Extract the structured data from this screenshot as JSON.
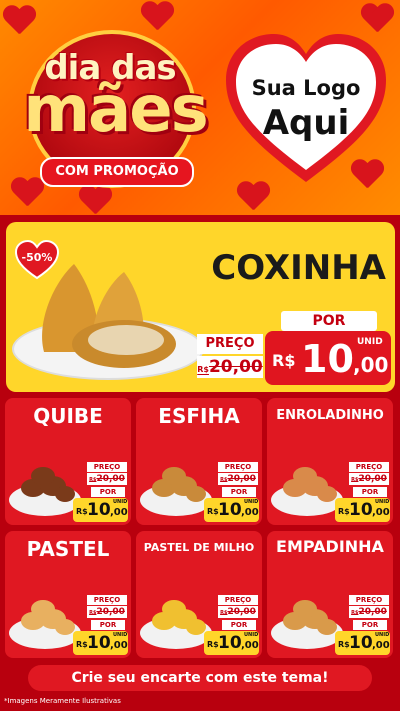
{
  "header": {
    "title_line1": "dia das",
    "title_line2": "mães",
    "promo_label": "COM PROMOÇÃO",
    "logo_line1": "Sua Logo",
    "logo_line2": "Aqui"
  },
  "featured": {
    "discount": "-50%",
    "name": "COXINHA",
    "price_label": "PREÇO",
    "old_currency": "R$",
    "old_price": "20,00",
    "por_label": "POR",
    "currency": "R$",
    "price_int": "10",
    "price_dec": ",00",
    "unit": "UNID"
  },
  "products": [
    {
      "name": "QUIBE",
      "price_label": "PREÇO",
      "old_price": "20,00",
      "old_currency": "R$",
      "por_label": "POR",
      "currency": "R$",
      "price_int": "10",
      "price_dec": ",00",
      "unit": "UNID"
    },
    {
      "name": "ESFIHA",
      "price_label": "PREÇO",
      "old_price": "20,00",
      "old_currency": "R$",
      "por_label": "POR",
      "currency": "R$",
      "price_int": "10",
      "price_dec": ",00",
      "unit": "UNID"
    },
    {
      "name": "ENROLADINHO",
      "price_label": "PREÇO",
      "old_price": "20,00",
      "old_currency": "R$",
      "por_label": "POR",
      "currency": "R$",
      "price_int": "10",
      "price_dec": ",00",
      "unit": "UNID"
    },
    {
      "name": "PASTEL",
      "price_label": "PREÇO",
      "old_price": "20,00",
      "old_currency": "R$",
      "por_label": "POR",
      "currency": "R$",
      "price_int": "10",
      "price_dec": ",00",
      "unit": "UNID"
    },
    {
      "name": "PASTEL DE MILHO",
      "price_label": "PREÇO",
      "old_price": "20,00",
      "old_currency": "R$",
      "por_label": "POR",
      "currency": "R$",
      "price_int": "10",
      "price_dec": ",00",
      "unit": "UNID"
    },
    {
      "name": "EMPADINHA",
      "price_label": "PREÇO",
      "old_price": "20,00",
      "old_currency": "R$",
      "por_label": "POR",
      "currency": "R$",
      "price_int": "10",
      "price_dec": ",00",
      "unit": "UNID"
    }
  ],
  "footer": {
    "cta": "Crie seu encarte com este tema!",
    "disclaimer": "*Imagens Meramente Ilustrativas"
  },
  "colors": {
    "brand_red": "#e01822",
    "brand_yellow": "#ffd62a",
    "header_orange": "#ff6a00"
  }
}
